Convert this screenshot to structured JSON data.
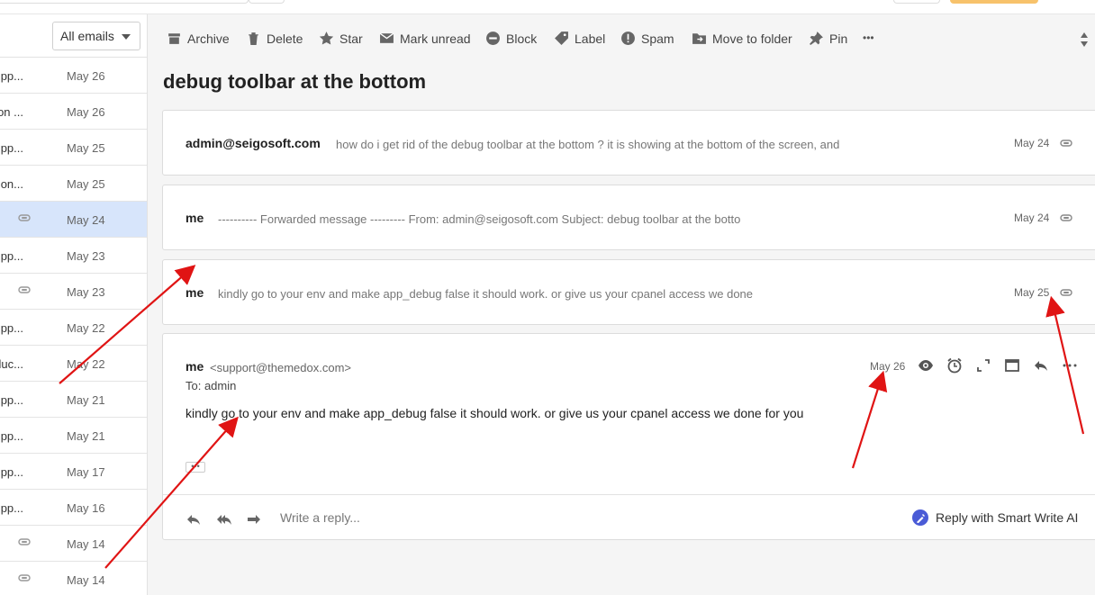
{
  "filter": {
    "label": "All emails"
  },
  "list_items": [
    {
      "snippet": "pp...",
      "date": "May 26",
      "clip": false,
      "selected": false
    },
    {
      "snippet": "on ...",
      "date": "May 26",
      "clip": false,
      "selected": false
    },
    {
      "snippet": "pp...",
      "date": "May 25",
      "clip": false,
      "selected": false
    },
    {
      "snippet": "on...",
      "date": "May 25",
      "clip": false,
      "selected": false
    },
    {
      "snippet": "",
      "date": "May 24",
      "clip": true,
      "selected": true
    },
    {
      "snippet": "pp...",
      "date": "May 23",
      "clip": false,
      "selected": false
    },
    {
      "snippet": "",
      "date": "May 23",
      "clip": true,
      "selected": false
    },
    {
      "snippet": "pp...",
      "date": "May 22",
      "clip": false,
      "selected": false
    },
    {
      "snippet": "luc...",
      "date": "May 22",
      "clip": false,
      "selected": false
    },
    {
      "snippet": "pp...",
      "date": "May 21",
      "clip": false,
      "selected": false
    },
    {
      "snippet": "pp...",
      "date": "May 21",
      "clip": false,
      "selected": false
    },
    {
      "snippet": "pp...",
      "date": "May 17",
      "clip": false,
      "selected": false
    },
    {
      "snippet": "pp...",
      "date": "May 16",
      "clip": false,
      "selected": false
    },
    {
      "snippet": "",
      "date": "May 14",
      "clip": true,
      "selected": false
    },
    {
      "snippet": "",
      "date": "May 14",
      "clip": true,
      "selected": false
    }
  ],
  "toolbar": {
    "archive": "Archive",
    "delete": "Delete",
    "star": "Star",
    "mark_unread": "Mark unread",
    "block": "Block",
    "label": "Label",
    "spam": "Spam",
    "move": "Move to folder",
    "pin": "Pin",
    "more": "•••"
  },
  "thread": {
    "subject": "debug toolbar at the bottom",
    "messages": [
      {
        "sender": "admin@seigosoft.com",
        "snippet": "how do i get rid of the debug toolbar at the bottom ? it is showing at the bottom of the screen, and",
        "date": "May 24"
      },
      {
        "sender": "me",
        "snippet": "---------- Forwarded message --------- From: admin@seigosoft.com Subject: debug toolbar at the botto",
        "date": "May 24"
      },
      {
        "sender": "me",
        "snippet": "kindly go to your env and make app_debug false it should work. or give us your cpanel access we done",
        "date": "May 25"
      }
    ],
    "open": {
      "sender": "me",
      "email": "<support@themedox.com>",
      "to": "To: admin",
      "date": "May 26",
      "body": "kindly go to your env and make app_debug false it should work. or give us your cpanel access we done for you",
      "ellipsis": "•••"
    },
    "reply": {
      "placeholder": "Write a reply...",
      "smart_write": "Reply with Smart Write AI"
    }
  },
  "colors": {
    "selected": "#d7e5fb",
    "annotation": "#e01414",
    "smart_write": "#4a5bd6"
  }
}
